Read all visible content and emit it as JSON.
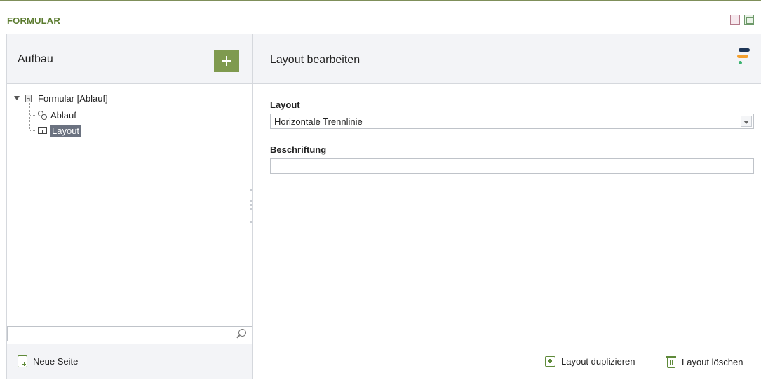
{
  "header": {
    "title": "FORMULAR"
  },
  "left_panel": {
    "title": "Aufbau",
    "tree": {
      "root": "Formular [Ablauf]",
      "children": [
        "Ablauf",
        "Layout"
      ]
    },
    "search": {
      "value": "",
      "placeholder": ""
    },
    "footer": {
      "new_page_label": "Neue Seite"
    }
  },
  "right_panel": {
    "title": "Layout bearbeiten",
    "fields": {
      "layout_label": "Layout",
      "layout_value": "Horizontale Trennlinie",
      "caption_label": "Beschriftung",
      "caption_value": ""
    },
    "footer": {
      "duplicate_label": "Layout duplizieren",
      "delete_label": "Layout löschen"
    }
  },
  "colors": {
    "accent_green": "#7f9a4f",
    "title_green": "#5a7a2e",
    "selection": "#6b7280"
  },
  "icons": [
    "document-icon",
    "window-icon",
    "plus-icon",
    "form-icon",
    "gear-icon",
    "layout-icon",
    "search-icon",
    "new-page-icon",
    "brand-logo",
    "duplicate-icon",
    "trash-icon"
  ]
}
